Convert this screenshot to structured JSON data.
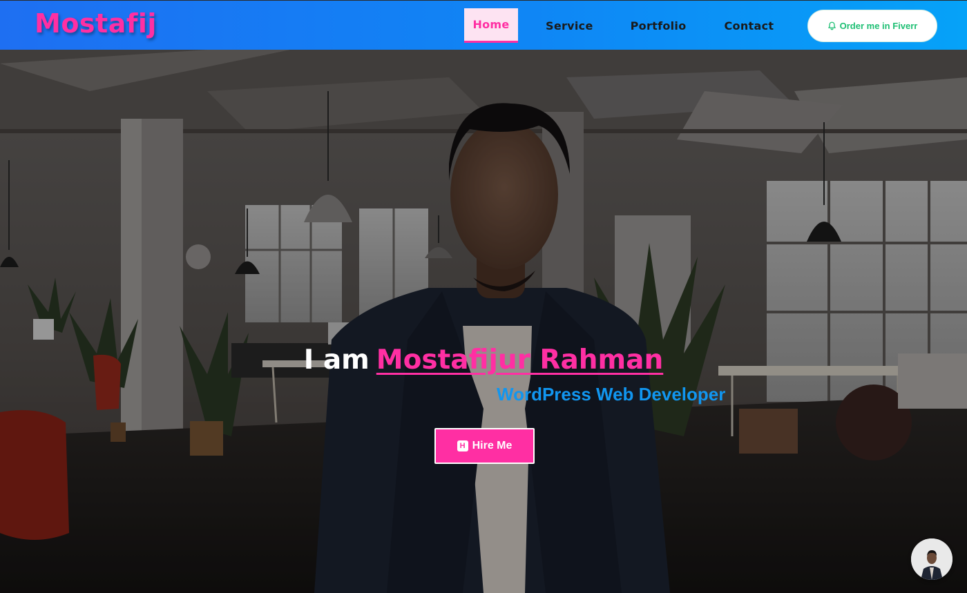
{
  "brand": {
    "logo_text": "Mostafij"
  },
  "nav": {
    "items": [
      {
        "label": "Home",
        "active": true
      },
      {
        "label": "Service",
        "active": false
      },
      {
        "label": "Portfolio",
        "active": false
      },
      {
        "label": "Contact",
        "active": false
      }
    ],
    "cta": {
      "label": "Order me in Fiverr",
      "icon": "bell-icon"
    }
  },
  "hero": {
    "intro": "I am",
    "name": "Mostafijur Rahman",
    "role": "WordPress Web Developer",
    "hire_button": {
      "label": "Hire Me",
      "icon": "hire-icon",
      "icon_glyph": "H"
    }
  },
  "chat_widget": {
    "icon": "profile-avatar"
  },
  "colors": {
    "accent_pink": "#ff2fa3",
    "nav_gradient_start": "#1e6ff2",
    "nav_gradient_end": "#06a2f8",
    "role_blue": "#1196f0",
    "fiverr_green": "#1dbf73"
  }
}
